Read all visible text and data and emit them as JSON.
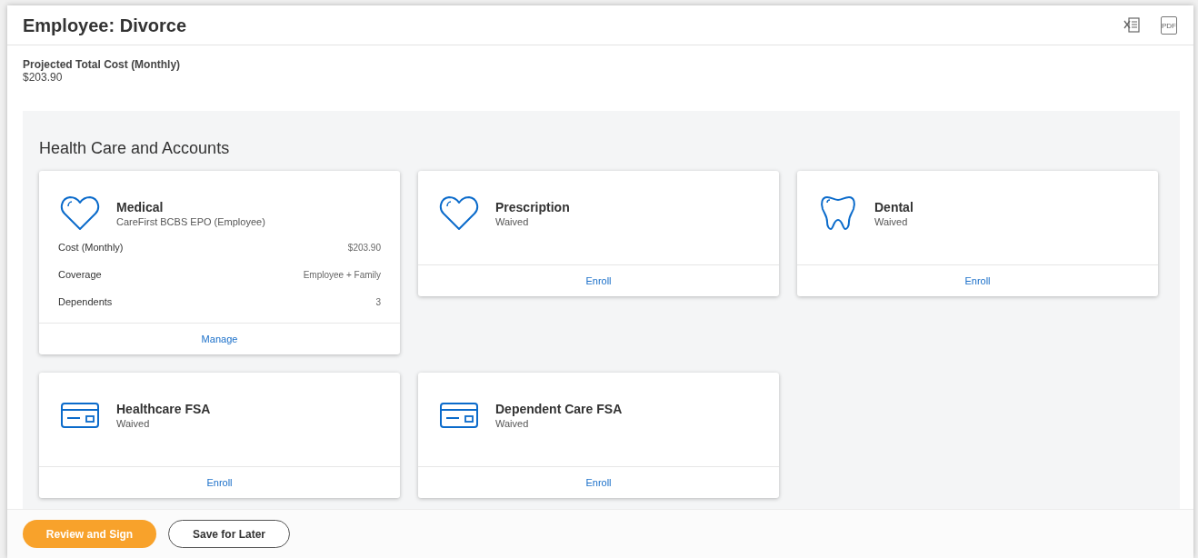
{
  "page": {
    "title": "Employee: Divorce"
  },
  "toolbar": [
    {
      "kind": "excel"
    },
    {
      "kind": "pdf",
      "label": "PDF"
    }
  ],
  "summary": {
    "label": "Projected Total Cost (Monthly)",
    "value": "$203.90"
  },
  "section": {
    "title": "Health Care and Accounts",
    "cards": [
      {
        "kind": "heart",
        "title": "Medical",
        "subtitle": "CareFirst BCBS EPO (Employee)",
        "details": [
          {
            "label": "Cost (Monthly)",
            "value": "$203.90"
          },
          {
            "label": "Coverage",
            "value": "Employee + Family"
          },
          {
            "label": "Dependents",
            "value": "3"
          }
        ],
        "action": "Manage"
      },
      {
        "kind": "heart",
        "title": "Prescription",
        "subtitle": "Waived",
        "action": "Enroll"
      },
      {
        "kind": "tooth",
        "title": "Dental",
        "subtitle": "Waived",
        "action": "Enroll"
      },
      {
        "kind": "card",
        "title": "Healthcare FSA",
        "subtitle": "Waived",
        "action": "Enroll"
      },
      {
        "kind": "card",
        "title": "Dependent Care FSA",
        "subtitle": "Waived",
        "action": "Enroll"
      }
    ]
  },
  "footer": {
    "buttons": [
      {
        "label": "Review and Sign",
        "primary": true
      },
      {
        "label": "Save for Later",
        "primary": false
      }
    ]
  }
}
